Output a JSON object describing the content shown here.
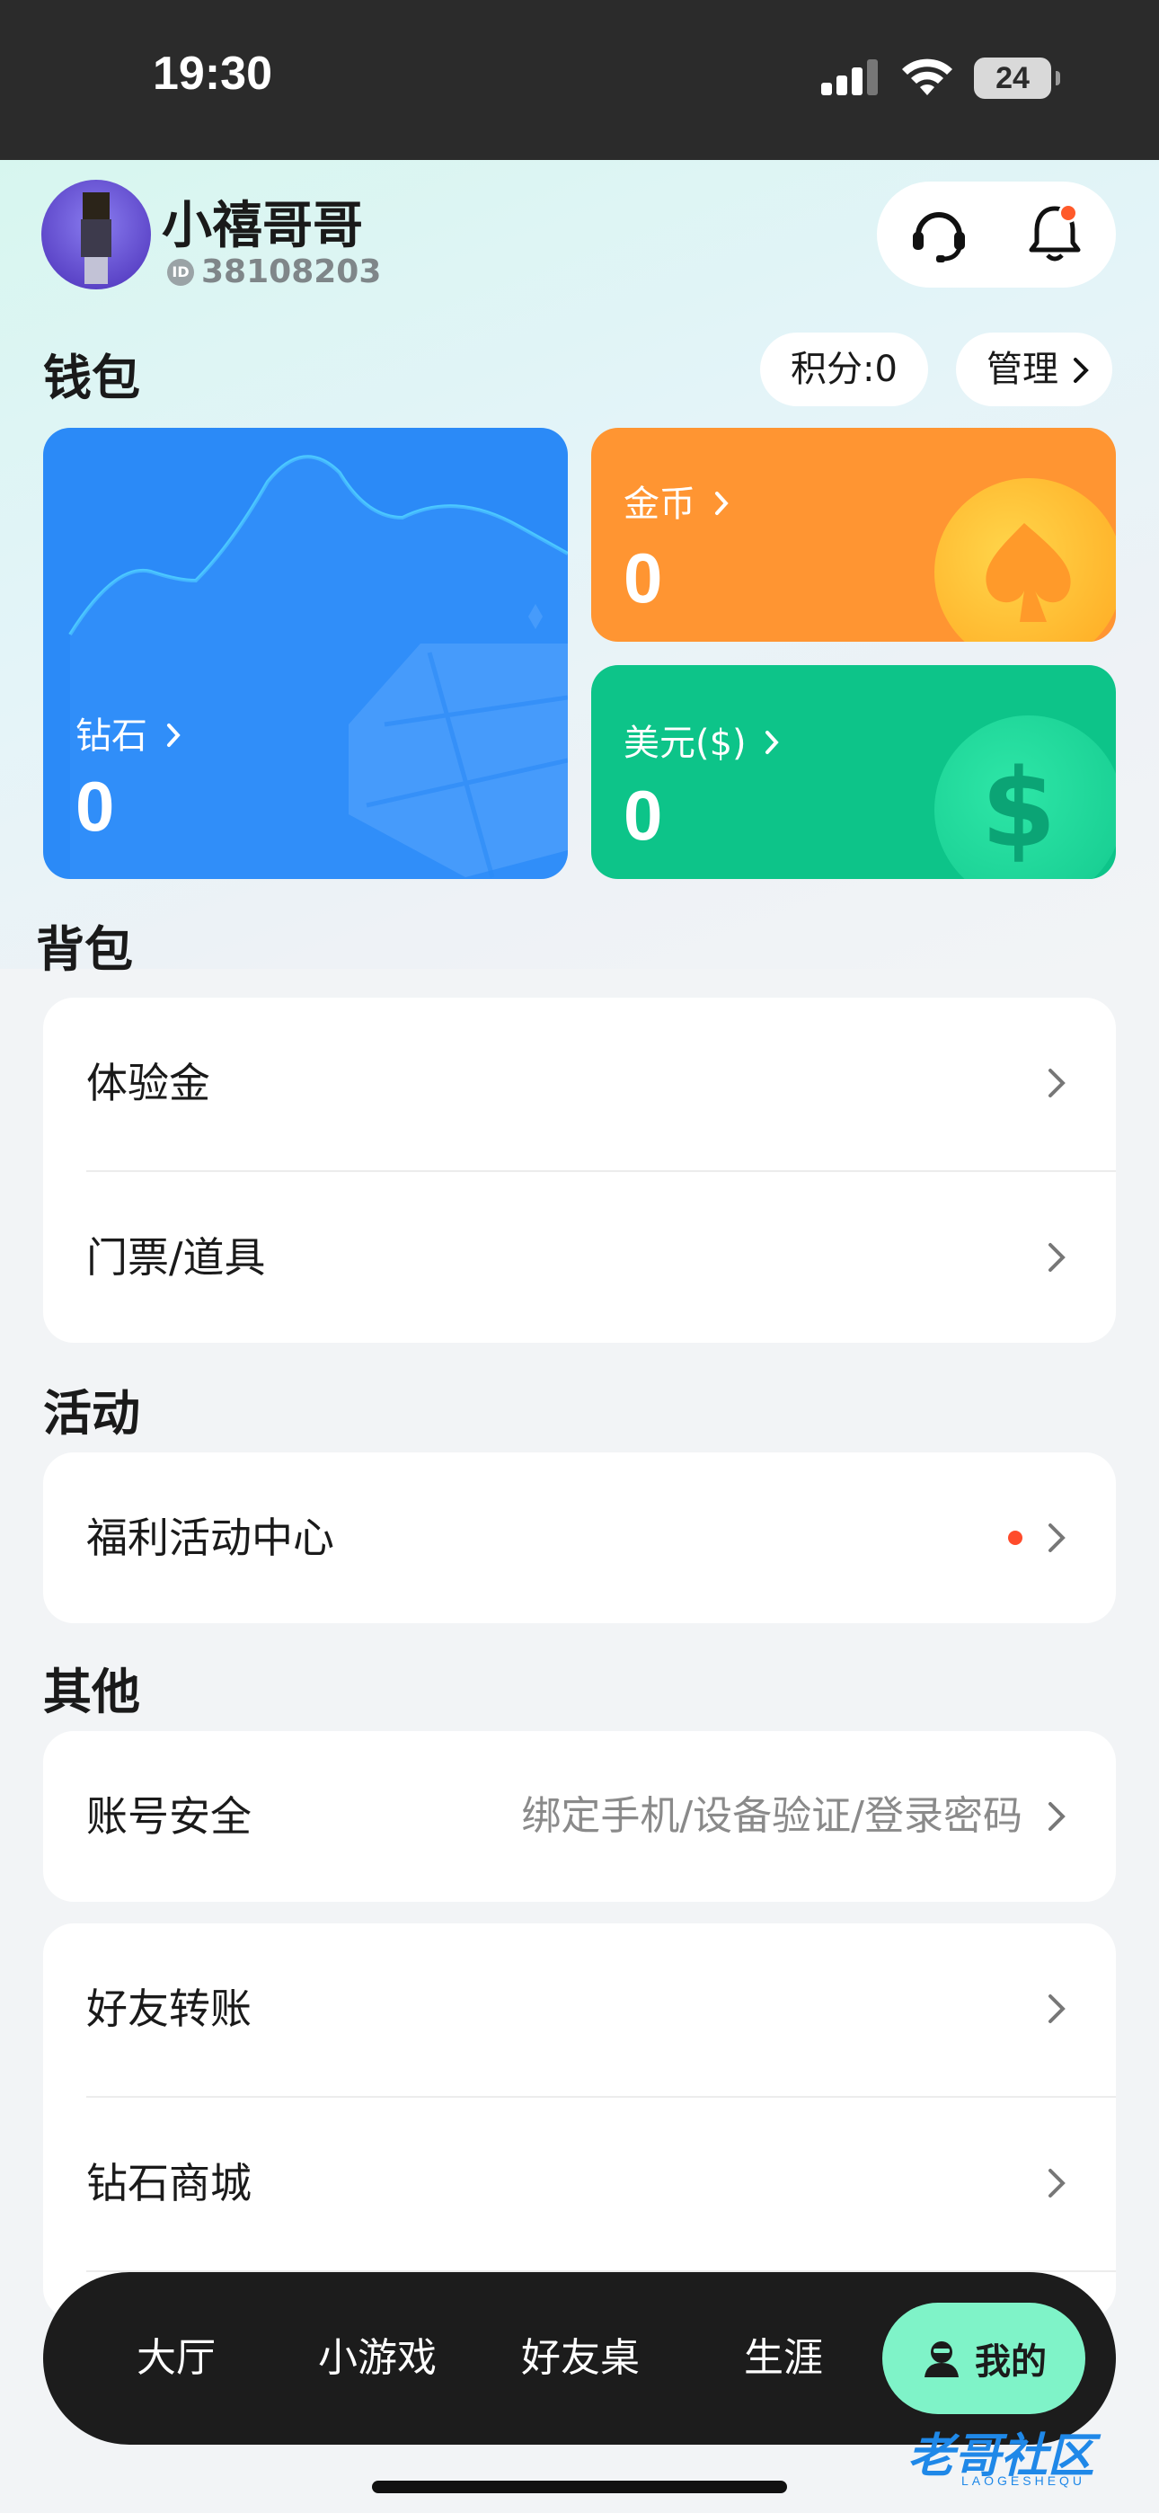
{
  "status_bar": {
    "time": "19:30",
    "battery": "24"
  },
  "profile": {
    "name": "小禧哥哥",
    "id_badge": "ID",
    "user_id": "38108203"
  },
  "wallet": {
    "title": "钱包",
    "points_label": "积分:0",
    "manage_label": "管理",
    "diamond": {
      "label": "钻石",
      "value": "0"
    },
    "coin": {
      "label": "金币",
      "value": "0"
    },
    "usd": {
      "label": "美元($)",
      "value": "0"
    }
  },
  "backpack": {
    "title": "背包",
    "items": [
      {
        "label": "体验金"
      },
      {
        "label": "门票/道具"
      }
    ]
  },
  "activity": {
    "title": "活动",
    "items": [
      {
        "label": "福利活动中心"
      }
    ]
  },
  "other": {
    "title": "其他",
    "account": {
      "label": "账号安全",
      "sub": "绑定手机/设备验证/登录密码"
    },
    "items": [
      {
        "label": "好友转账"
      },
      {
        "label": "钻石商城"
      }
    ]
  },
  "nav": {
    "items": [
      {
        "label": "大厅"
      },
      {
        "label": "小游戏"
      },
      {
        "label": "好友桌"
      },
      {
        "label": "生涯"
      }
    ],
    "active": {
      "label": "我的"
    }
  },
  "watermark": {
    "text": "老哥社区",
    "sub": "LAOGESHEQU"
  },
  "colors": {
    "diamond_card": "#2b8af7",
    "coin_card": "#ff9532",
    "usd_card": "#0dc489",
    "nav_active": "#7ff3c8",
    "notification_dot": "#ff5a2a"
  }
}
